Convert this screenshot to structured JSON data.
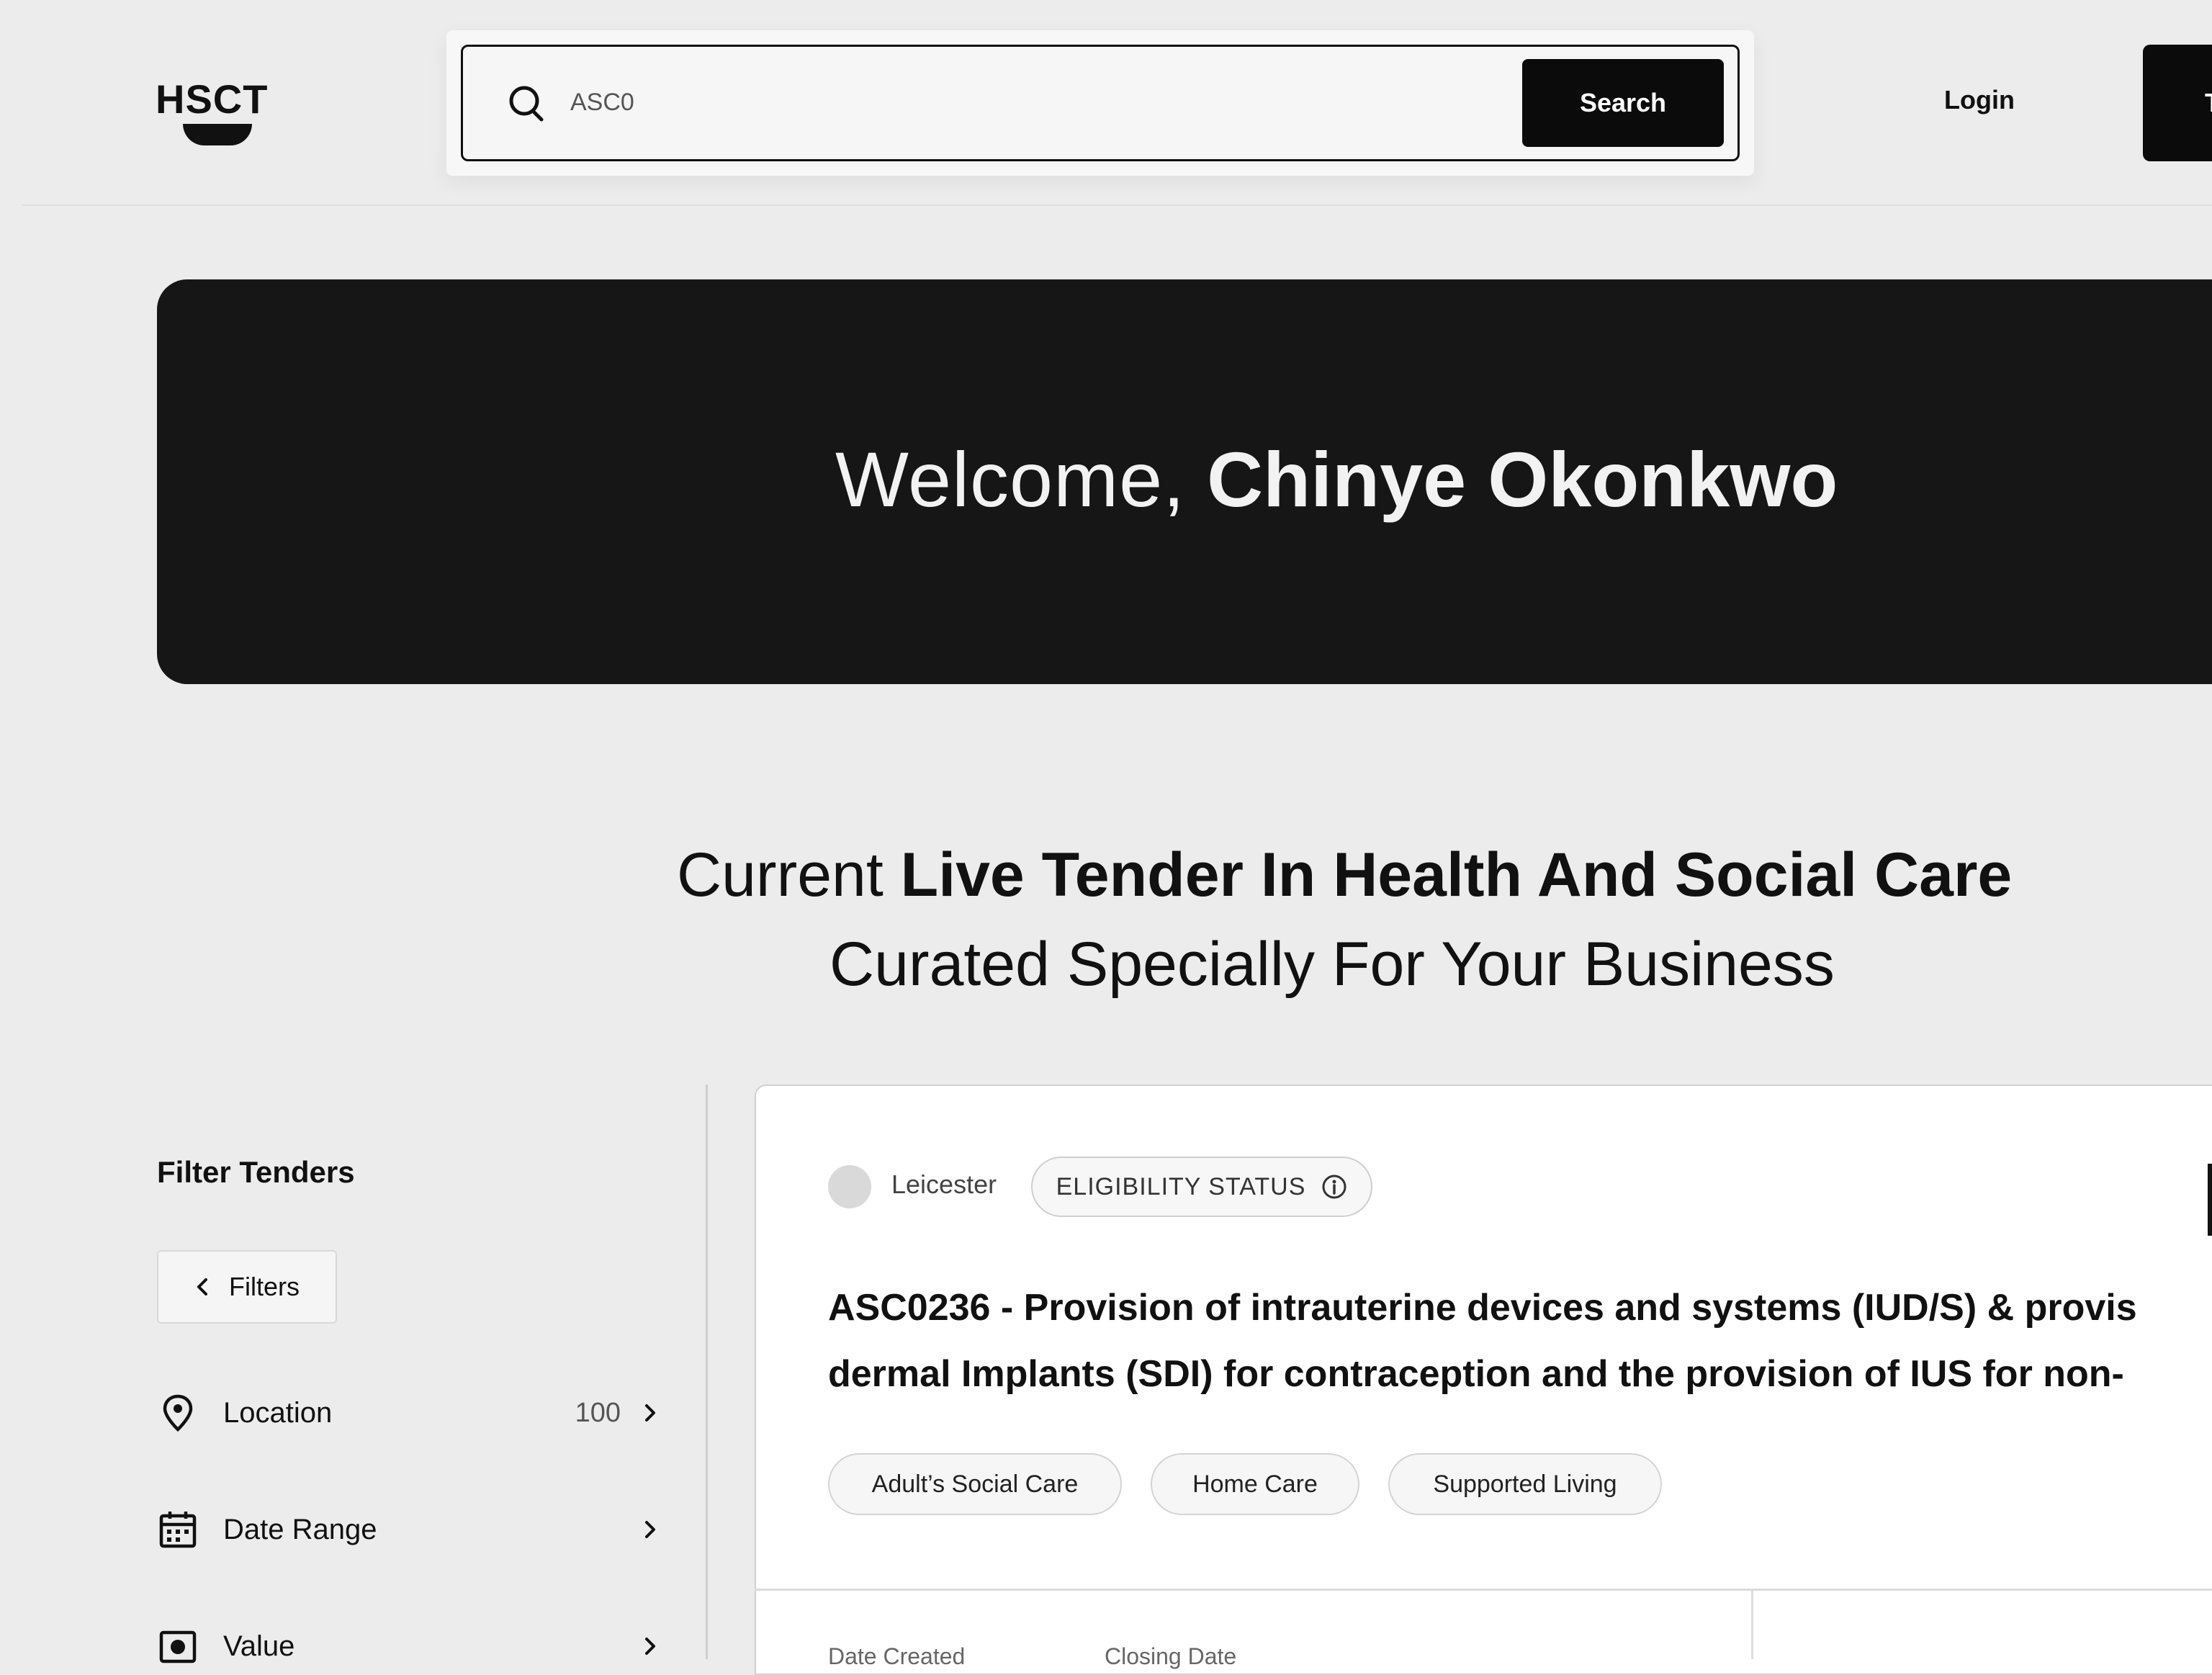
{
  "header": {
    "logo": "HSCT",
    "search": {
      "value": "ASC0",
      "button_label": "Search"
    },
    "login_label": "Login",
    "cta_label": "T"
  },
  "banner": {
    "greeting": "Welcome,",
    "name": "Chinye Okonkwo"
  },
  "section": {
    "heading_prefix": "Current",
    "heading_bold": "Live Tender In Health And Social Care",
    "subheading": "Curated Specially For Your Business"
  },
  "sidebar": {
    "title": "Filter Tenders",
    "filters_button": "Filters",
    "items": [
      {
        "label": "Location",
        "count": "100",
        "icon": "location-pin-icon"
      },
      {
        "label": "Date Range",
        "count": "",
        "icon": "calendar-icon"
      },
      {
        "label": "Value",
        "count": "",
        "icon": "value-icon"
      }
    ]
  },
  "tender": {
    "location": "Leicester",
    "eligibility_label": "ELIGIBILITY STATUS",
    "title_line1": "ASC0236 - Provision of intrauterine devices and systems (IUD/S) & provis",
    "title_line2": "dermal Implants (SDI) for contraception and the provision of IUS for non-",
    "tags": [
      "Adult’s Social Care",
      "Home Care",
      "Supported Living"
    ],
    "meta": {
      "date_created_label": "Date Created",
      "closing_date_label": "Closing Date"
    }
  }
}
